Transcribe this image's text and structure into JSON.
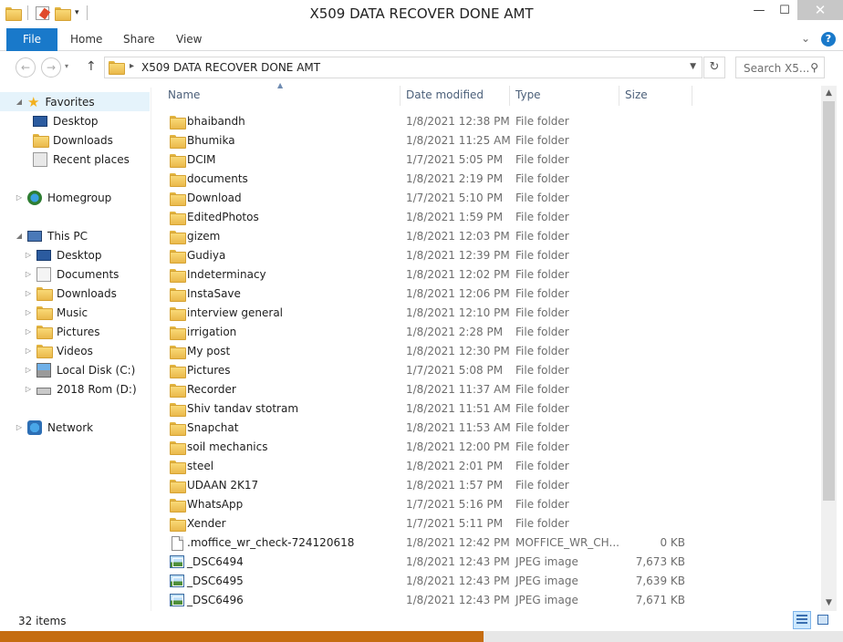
{
  "window": {
    "title": "X509 DATA RECOVER DONE AMT",
    "minimize": "—",
    "maximize": "☐",
    "close": "✕"
  },
  "ribbon": {
    "tabs": [
      "File",
      "Home",
      "Share",
      "View"
    ]
  },
  "address": {
    "path": "X509 DATA RECOVER DONE AMT",
    "search_placeholder": "Search X5..."
  },
  "nav": {
    "favorites": "Favorites",
    "fav_items": [
      "Desktop",
      "Downloads",
      "Recent places"
    ],
    "homegroup": "Homegroup",
    "thispc": "This PC",
    "pc_items": [
      "Desktop",
      "Documents",
      "Downloads",
      "Music",
      "Pictures",
      "Videos",
      "Local Disk (C:)",
      "2018 Rom (D:)"
    ],
    "network": "Network"
  },
  "columns": {
    "name": "Name",
    "date": "Date modified",
    "type": "Type",
    "size": "Size"
  },
  "files": [
    {
      "name": "bhaibandh",
      "date": "1/8/2021 12:38 PM",
      "type": "File folder",
      "size": "",
      "icon": "folder-icon"
    },
    {
      "name": "Bhumika",
      "date": "1/8/2021 11:25 AM",
      "type": "File folder",
      "size": "",
      "icon": "folder-icon"
    },
    {
      "name": "DCIM",
      "date": "1/7/2021 5:05 PM",
      "type": "File folder",
      "size": "",
      "icon": "folder-icon"
    },
    {
      "name": "documents",
      "date": "1/8/2021 2:19 PM",
      "type": "File folder",
      "size": "",
      "icon": "folder-icon"
    },
    {
      "name": "Download",
      "date": "1/7/2021 5:10 PM",
      "type": "File folder",
      "size": "",
      "icon": "folder-icon"
    },
    {
      "name": "EditedPhotos",
      "date": "1/8/2021 1:59 PM",
      "type": "File folder",
      "size": "",
      "icon": "folder-icon"
    },
    {
      "name": "gizem",
      "date": "1/8/2021 12:03 PM",
      "type": "File folder",
      "size": "",
      "icon": "folder-icon"
    },
    {
      "name": "Gudiya",
      "date": "1/8/2021 12:39 PM",
      "type": "File folder",
      "size": "",
      "icon": "folder-icon"
    },
    {
      "name": "Indeterminacy",
      "date": "1/8/2021 12:02 PM",
      "type": "File folder",
      "size": "",
      "icon": "folder-icon"
    },
    {
      "name": "InstaSave",
      "date": "1/8/2021 12:06 PM",
      "type": "File folder",
      "size": "",
      "icon": "folder-icon"
    },
    {
      "name": "interview general",
      "date": "1/8/2021 12:10 PM",
      "type": "File folder",
      "size": "",
      "icon": "folder-icon"
    },
    {
      "name": "irrigation",
      "date": "1/8/2021 2:28 PM",
      "type": "File folder",
      "size": "",
      "icon": "folder-icon"
    },
    {
      "name": "My post",
      "date": "1/8/2021 12:30 PM",
      "type": "File folder",
      "size": "",
      "icon": "folder-icon"
    },
    {
      "name": "Pictures",
      "date": "1/7/2021 5:08 PM",
      "type": "File folder",
      "size": "",
      "icon": "folder-icon"
    },
    {
      "name": "Recorder",
      "date": "1/8/2021 11:37 AM",
      "type": "File folder",
      "size": "",
      "icon": "folder-icon"
    },
    {
      "name": "Shiv tandav stotram",
      "date": "1/8/2021 11:51 AM",
      "type": "File folder",
      "size": "",
      "icon": "folder-icon"
    },
    {
      "name": "Snapchat",
      "date": "1/8/2021 11:53 AM",
      "type": "File folder",
      "size": "",
      "icon": "folder-icon"
    },
    {
      "name": "soil mechanics",
      "date": "1/8/2021 12:00 PM",
      "type": "File folder",
      "size": "",
      "icon": "folder-icon"
    },
    {
      "name": "steel",
      "date": "1/8/2021 2:01 PM",
      "type": "File folder",
      "size": "",
      "icon": "folder-icon"
    },
    {
      "name": "UDAAN 2K17",
      "date": "1/8/2021 1:57 PM",
      "type": "File folder",
      "size": "",
      "icon": "folder-icon"
    },
    {
      "name": "WhatsApp",
      "date": "1/7/2021 5:16 PM",
      "type": "File folder",
      "size": "",
      "icon": "folder-icon"
    },
    {
      "name": "Xender",
      "date": "1/7/2021 5:11 PM",
      "type": "File folder",
      "size": "",
      "icon": "folder-icon"
    },
    {
      "name": ".moffice_wr_check-724120618",
      "date": "1/8/2021 12:42 PM",
      "type": "MOFFICE_WR_CH...",
      "size": "0 KB",
      "icon": "document-icon"
    },
    {
      "name": "_DSC6494",
      "date": "1/8/2021 12:43 PM",
      "type": "JPEG image",
      "size": "7,673 KB",
      "icon": "image-icon"
    },
    {
      "name": "_DSC6495",
      "date": "1/8/2021 12:43 PM",
      "type": "JPEG image",
      "size": "7,639 KB",
      "icon": "image-icon"
    },
    {
      "name": "_DSC6496",
      "date": "1/8/2021 12:43 PM",
      "type": "JPEG image",
      "size": "7,671 KB",
      "icon": "image-icon"
    }
  ],
  "status": {
    "item_count": "32 items"
  }
}
